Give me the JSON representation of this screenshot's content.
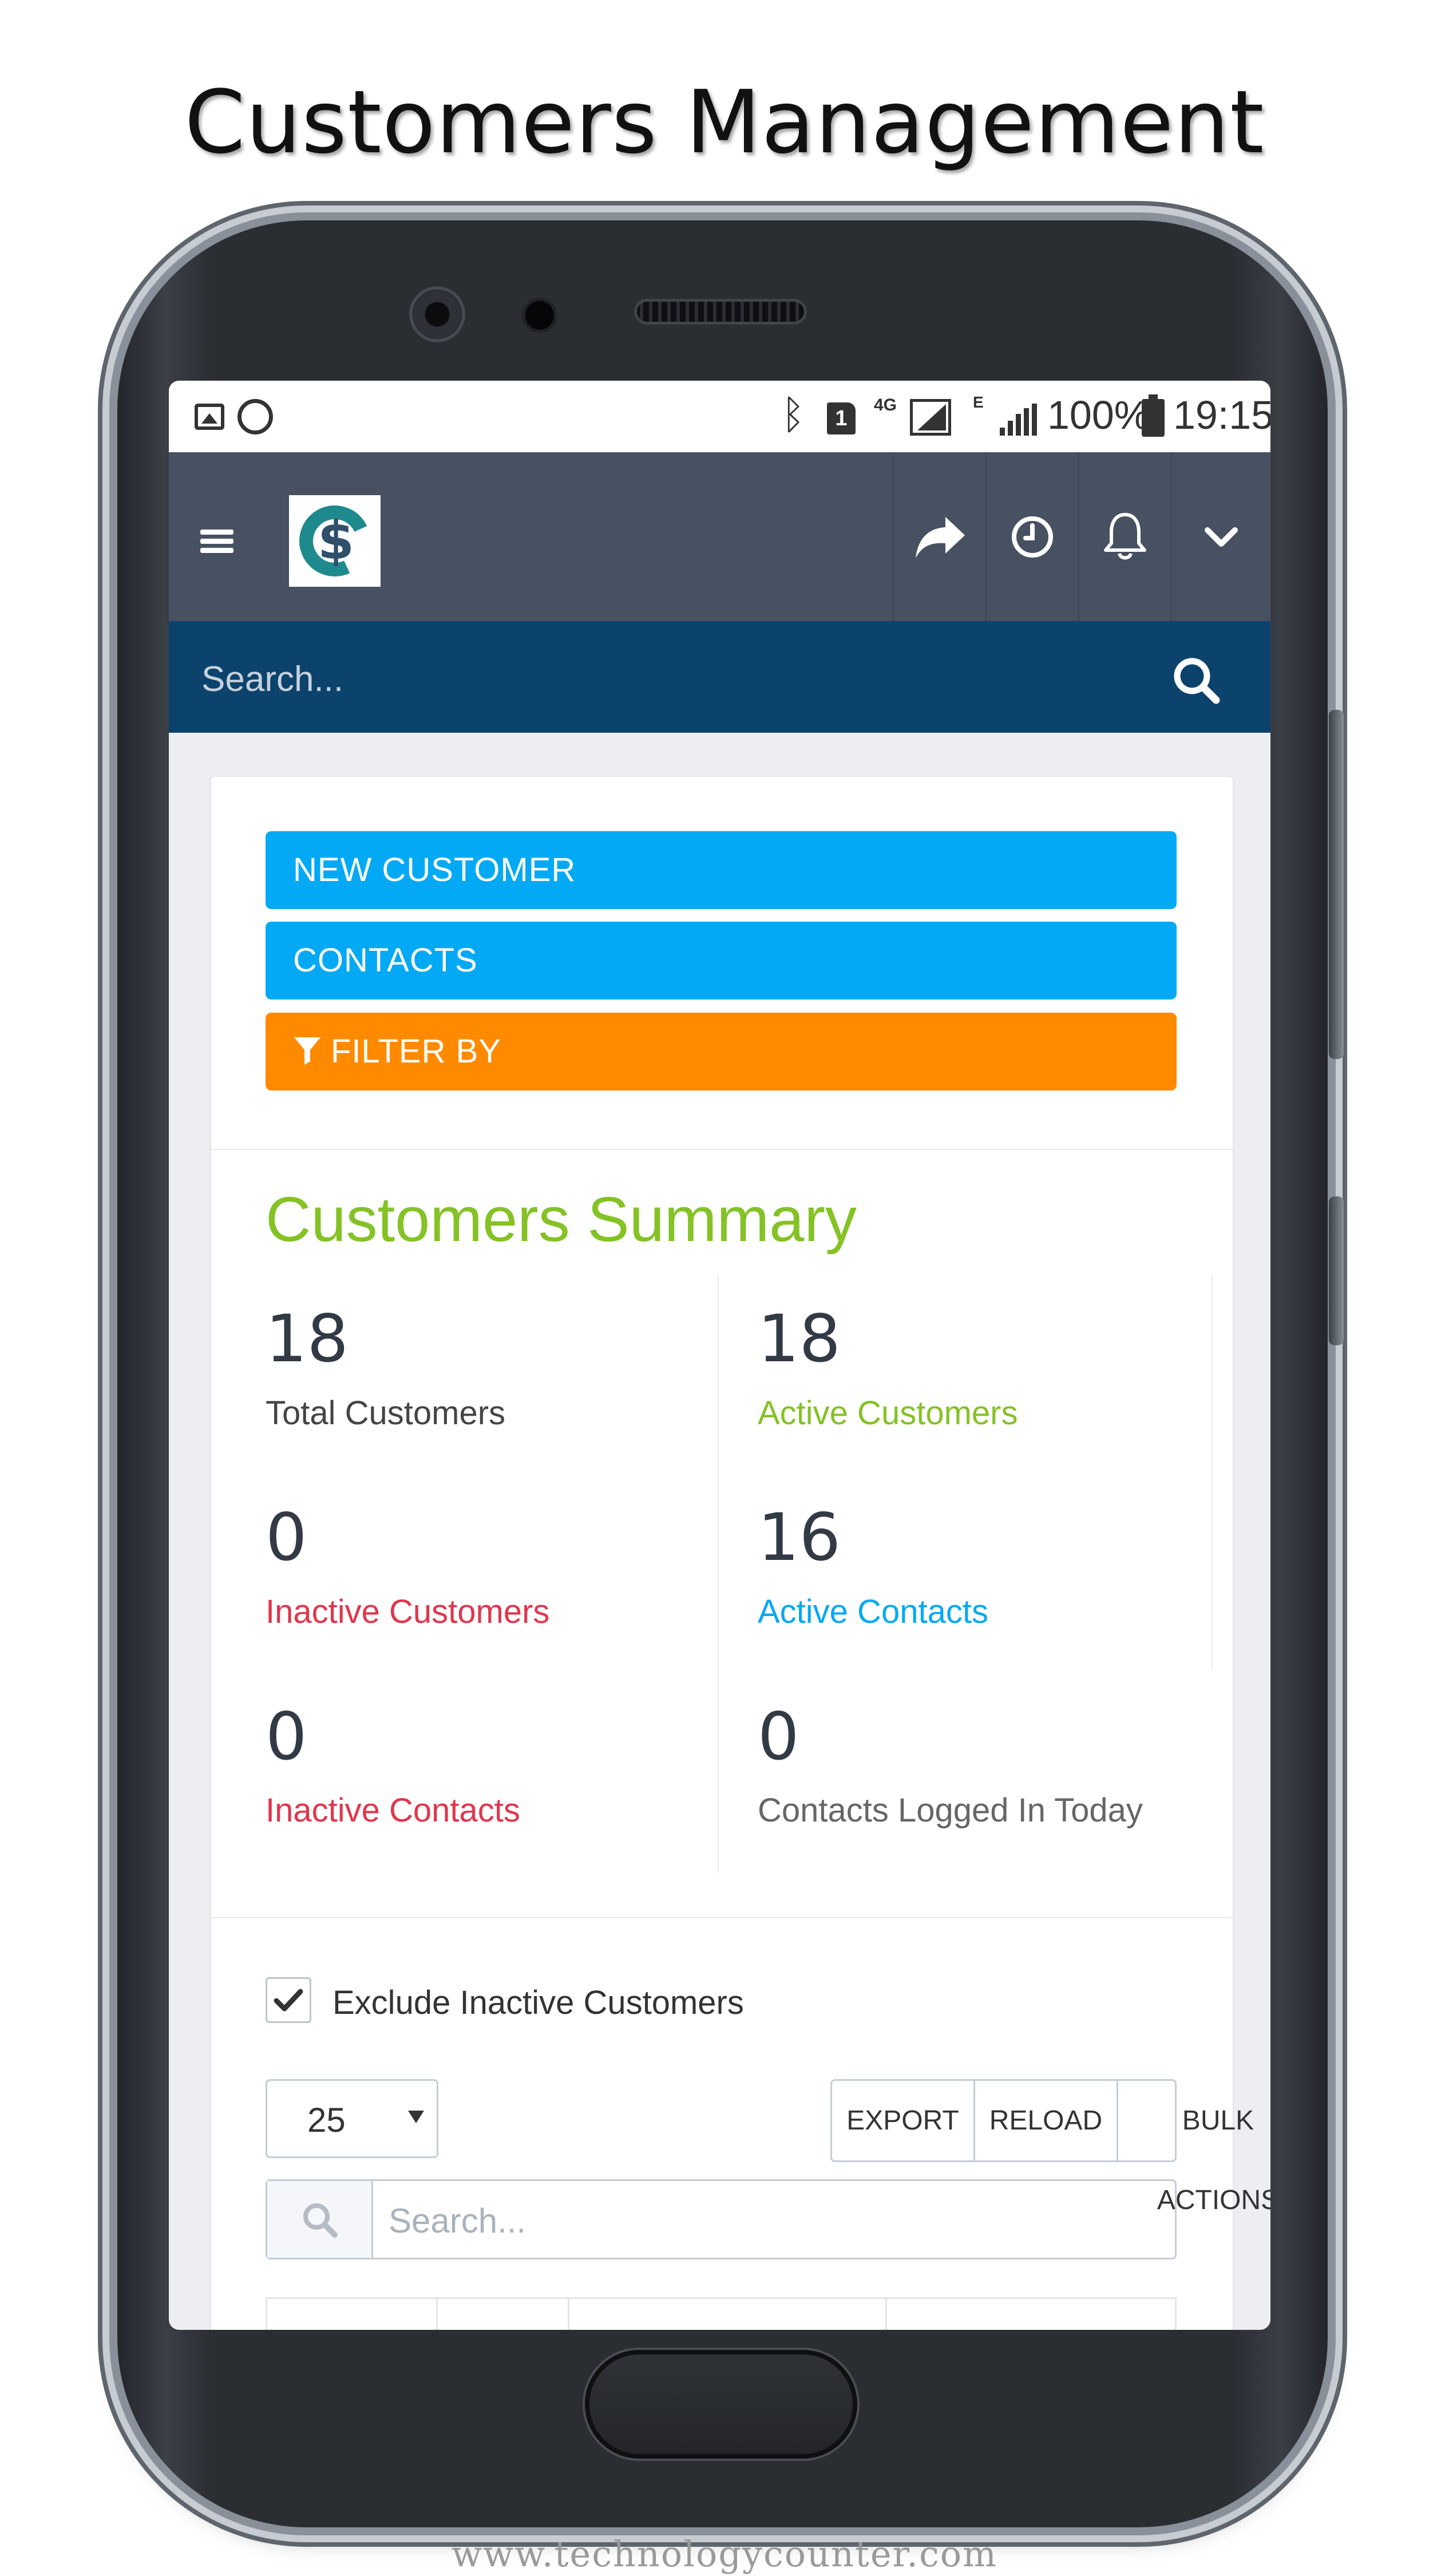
{
  "page": {
    "title": "Customers Management",
    "footer_url": "www.technologycounter.com"
  },
  "status_bar": {
    "icons": [
      "gallery-icon",
      "whatsapp-icon",
      "bluetooth-icon",
      "sim-icon",
      "network-4g-icon",
      "signal-icon",
      "network-e-icon",
      "signal-icon",
      "battery-icon"
    ],
    "sim_number": "1",
    "network_4g": "4G",
    "network_e": "E",
    "battery_percent": "100%",
    "time": "19:15"
  },
  "header": {
    "menu_icon": "hamburger-menu-icon",
    "logo_icon": "company-logo",
    "logo_glyph": "$",
    "actions": [
      {
        "name": "share",
        "icon": "share-arrow-icon"
      },
      {
        "name": "timesheet",
        "icon": "clock-icon"
      },
      {
        "name": "notifications",
        "icon": "bell-icon"
      },
      {
        "name": "user-menu",
        "icon": "chevron-down-icon"
      }
    ],
    "background_color": "#475162"
  },
  "top_search": {
    "placeholder": "Search...",
    "icon": "search-icon",
    "background_color": "#0b436d"
  },
  "actions": {
    "new_customer": "NEW CUSTOMER",
    "contacts": "CONTACTS",
    "filter_by": "FILTER BY",
    "primary_color": "#03a9f4",
    "filter_color": "#ff8a00"
  },
  "summary": {
    "title": "Customers Summary",
    "title_color": "#84c225",
    "stats": [
      {
        "value": "18",
        "label": "Total Customers",
        "color": "#444444"
      },
      {
        "value": "18",
        "label": "Active Customers",
        "color": "#84c225"
      },
      {
        "value": "0",
        "label": "Inactive Customers",
        "color": "#e0364c"
      },
      {
        "value": "16",
        "label": "Active Contacts",
        "color": "#03a9f4"
      },
      {
        "value": "0",
        "label": "Inactive Contacts",
        "color": "#e0364c"
      },
      {
        "value": "0",
        "label": "Contacts Logged In Today",
        "color": "#666666"
      }
    ]
  },
  "filters": {
    "exclude_inactive_label": "Exclude Inactive Customers",
    "exclude_inactive_checked": true
  },
  "table_controls": {
    "page_size": "25",
    "export": "EXPORT",
    "reload": "RELOAD",
    "bulk_actions": "BULK ACTIONS",
    "search_placeholder": "Search..."
  }
}
